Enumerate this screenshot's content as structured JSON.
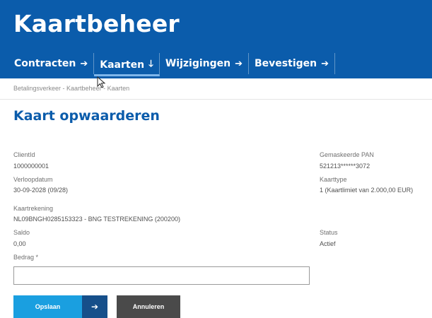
{
  "app": {
    "title": "Kaartbeheer"
  },
  "nav": [
    {
      "label": "Contracten",
      "arrow": "➔"
    },
    {
      "label": "Kaarten",
      "arrow": "🡓"
    },
    {
      "label": "Wijzigingen",
      "arrow": "➔"
    },
    {
      "label": "Bevestigen",
      "arrow": "➔"
    }
  ],
  "breadcrumb": "Betalingsverkeer - Kaartbeheer - Kaarten",
  "page": {
    "title": "Kaart opwaarderen"
  },
  "fields": {
    "client_id": {
      "label": "ClientId",
      "value": "1000000001"
    },
    "masked_pan": {
      "label": "Gemaskeerde PAN",
      "value": "521213******3072"
    },
    "expiry": {
      "label": "Verloopdatum",
      "value": "30-09-2028 (09/28)"
    },
    "card_type": {
      "label": "Kaarttype",
      "value": "1 (Kaartlimiet van 2.000,00 EUR)"
    },
    "card_account": {
      "label": "Kaartrekening",
      "value": "NL09BNGH0285153323 - BNG TESTREKENING (200200)"
    },
    "balance": {
      "label": "Saldo",
      "value": "0,00"
    },
    "status": {
      "label": "Status",
      "value": "Actief"
    },
    "amount": {
      "label": "Bedrag *",
      "value": "",
      "placeholder": ""
    }
  },
  "buttons": {
    "save": "Opslaan",
    "save_icon": "➔",
    "cancel": "Annuleren"
  },
  "colors": {
    "header": "#0b5cab",
    "save_button": "#1a9fe0",
    "save_icon_bg": "#164f8a",
    "cancel_button": "#4a4a4a"
  }
}
